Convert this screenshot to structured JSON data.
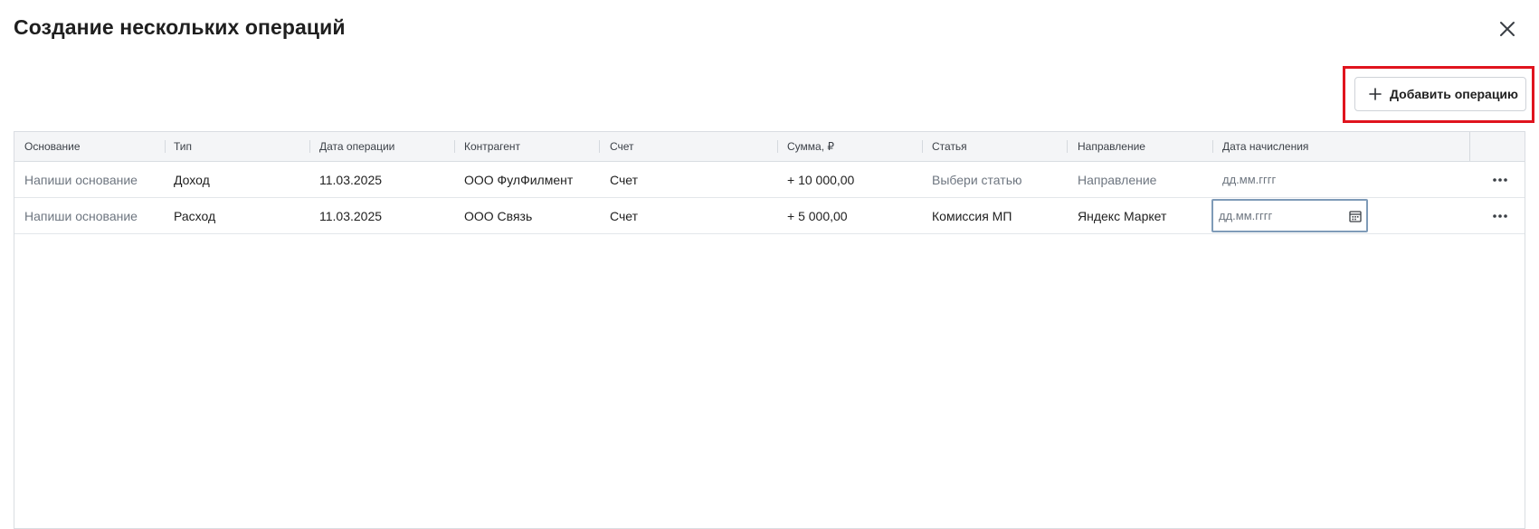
{
  "dialog": {
    "title": "Создание нескольких операций",
    "add_button_label": "Добавить операцию"
  },
  "table": {
    "columns": [
      "Основание",
      "Тип",
      "Дата операции",
      "Контрагент",
      "Счет",
      "Сумма, ₽",
      "Статья",
      "Направление",
      "Дата начисления"
    ],
    "rows": [
      {
        "basis": "Напиши основание",
        "type": "Доход",
        "date": "11.03.2025",
        "counterparty": "ООО ФулФилмент",
        "account": "Счет",
        "amount": "+ 10 000,00",
        "article": "Выбери статью",
        "direction": "Направление",
        "accrual_date": "дд.мм.гггг"
      },
      {
        "basis": "Напиши основание",
        "type": "Расход",
        "date": "11.03.2025",
        "counterparty": "ООО Связь",
        "account": "Счет",
        "amount": "+ 5 000,00",
        "article": "Комиссия МП",
        "direction": "Яндекс Маркет",
        "accrual_date": "дд.мм.гггг"
      }
    ]
  },
  "icons": {
    "close": "close-icon",
    "add": "plus-icon",
    "more": "more-horizontal-icon",
    "calendar": "calendar-icon"
  },
  "colors": {
    "highlight": "#e0141e",
    "header_bg": "#f4f5f7",
    "placeholder_text": "#6e7680",
    "focused_border": "#7f9bb8"
  }
}
